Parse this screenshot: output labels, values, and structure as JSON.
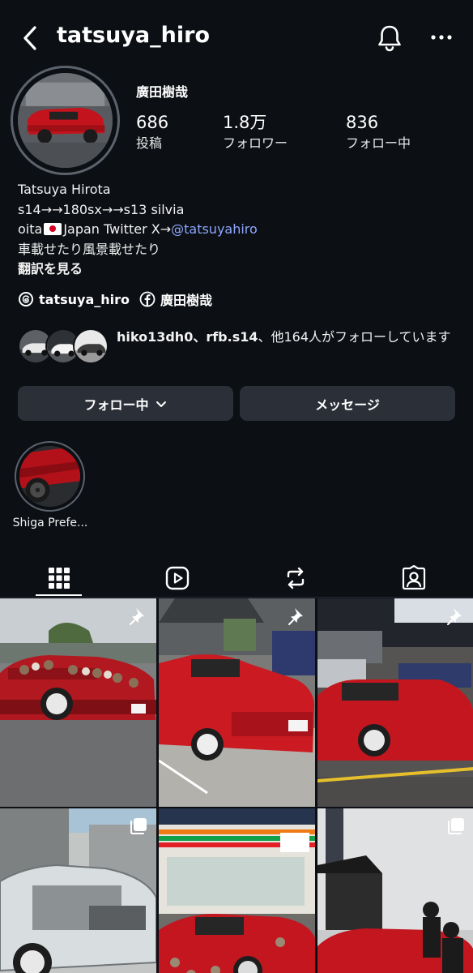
{
  "header": {
    "username": "tatsuya_hiro",
    "back_icon": "chevron-left-icon",
    "bell_icon": "bell-icon",
    "more_icon": "more-horizontal-icon"
  },
  "profile": {
    "display_name": "廣田樹哉",
    "stats": [
      {
        "value": "686",
        "label": "投稿"
      },
      {
        "value": "1.8万",
        "label": "フォロワー"
      },
      {
        "value": "836",
        "label": "フォロー中"
      }
    ],
    "bio": {
      "line1": "Tatsuya Hirota",
      "line2": "s14→→180sx→→s13 silvia",
      "line3_prefix": "oita",
      "line3_middle": "Japan Twitter X→",
      "line3_link": "@tatsuyahiro",
      "line4": "車載せたり風景載せたり",
      "translate": "翻訳を見る"
    },
    "links": [
      {
        "icon": "threads-icon",
        "text": "tatsuya_hiro"
      },
      {
        "icon": "facebook-icon",
        "text": "廣田樹哉"
      }
    ],
    "followed_by": {
      "names": "hiko13dh0、rfb.s14",
      "rest": "、他164人がフォローしています"
    }
  },
  "actions": {
    "following_label": "フォロー中",
    "message_label": "メッセージ"
  },
  "highlights": [
    {
      "label": "Shiga Prefe..."
    }
  ],
  "tabs": [
    {
      "name": "grid",
      "icon": "grid-icon",
      "active": true
    },
    {
      "name": "reels",
      "icon": "reels-icon",
      "active": false
    },
    {
      "name": "reposts",
      "icon": "repost-icon",
      "active": false
    },
    {
      "name": "tagged",
      "icon": "tagged-user-icon",
      "active": false
    }
  ],
  "colors": {
    "background": "#0c0f14",
    "button": "#2b3038",
    "link": "#8ea8ff"
  },
  "posts": [
    {
      "badge": "pin-icon"
    },
    {
      "badge": "pin-icon"
    },
    {
      "badge": "pin-icon"
    },
    {
      "badge": "carousel-icon"
    },
    {
      "badge": "none"
    },
    {
      "badge": "carousel-icon"
    }
  ]
}
